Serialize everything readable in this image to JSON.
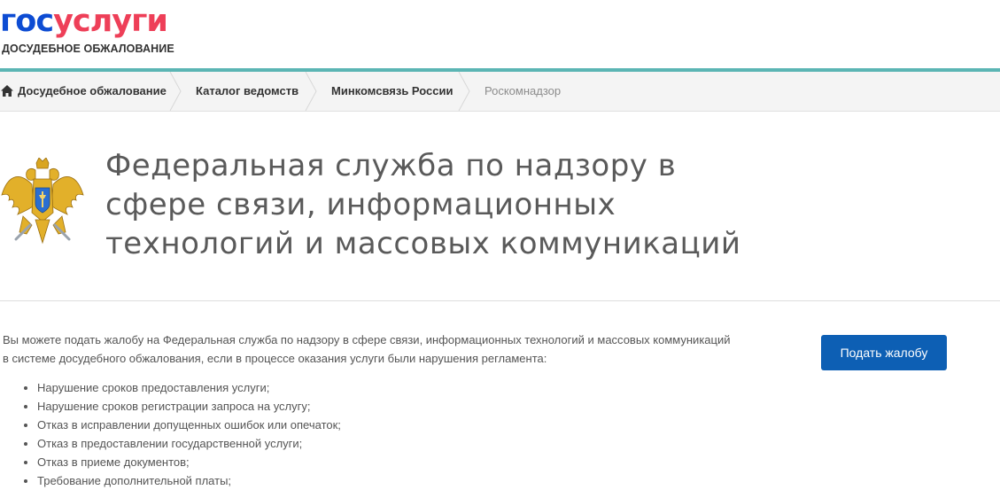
{
  "header": {
    "logo_gos": "гос",
    "logo_uslugi": "услуги",
    "logo_subtitle": "ДОСУДЕБНОЕ ОБЖАЛОВАНИЕ",
    "logo_color_blue": "#0d4cd3",
    "logo_color_red": "#ee3f58",
    "accent_line_color": "#5bb5b4"
  },
  "breadcrumbs": {
    "home_icon": "home-icon",
    "items": [
      {
        "label": "Досудебное обжалование"
      },
      {
        "label": "Каталог ведомств"
      },
      {
        "label": "Минкомсвязь России"
      },
      {
        "label": "Роскомнадзор"
      }
    ]
  },
  "agency": {
    "emblem": "double-headed-eagle-emblem",
    "title": "Федеральная служба по надзору в сфере связи, информационных технологий и массовых коммуникаций"
  },
  "content": {
    "intro": "Вы можете подать жалобу на Федеральная служба по надзору в сфере связи, информационных технологий и массовых коммуникаций в системе досудебного обжалования, если в процессе оказания услуги были нарушения регламента:",
    "button_label": "Подать жалобу",
    "button_color": "#0d5fb4",
    "violations": [
      "Нарушение сроков предоставления услуги;",
      "Нарушение сроков регистрации запроса на услугу;",
      "Отказ в исправлении допущенных ошибок или опечаток;",
      "Отказ в предоставлении государственной услуги;",
      "Отказ в приеме документов;",
      "Требование дополнительной платы;"
    ]
  }
}
